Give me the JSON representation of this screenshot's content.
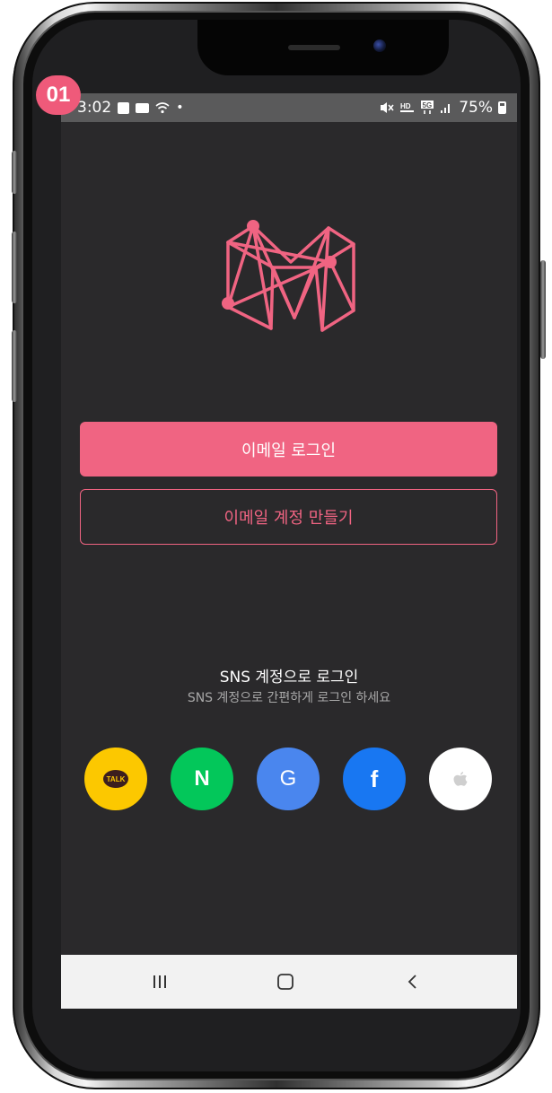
{
  "step_badge": "01",
  "status_bar": {
    "time": "3:02",
    "left_icons": [
      "image-icon",
      "message-icon",
      "wifi-icon",
      "dot-icon"
    ],
    "right_icons": [
      "mute-icon",
      "hd-voice-icon",
      "5g-icon",
      "signal-icon"
    ],
    "battery": "75%"
  },
  "app": {
    "logo": "m-network-logo",
    "brand_color": "#f06482"
  },
  "auth": {
    "login_label": "이메일 로그인",
    "signup_label": "이메일 계정 만들기"
  },
  "sns": {
    "title": "SNS 계정으로 로그인",
    "subtitle": "SNS 계정으로 간편하게 로그인 하세요",
    "providers": [
      {
        "name": "kakao",
        "icon": "kakao-talk-icon",
        "text": "TALK",
        "color": "#fee500"
      },
      {
        "name": "naver",
        "icon": "naver-icon",
        "text": "N",
        "color": "#03c75a"
      },
      {
        "name": "google",
        "icon": "google-icon",
        "text": "G",
        "color": "#4285f4"
      },
      {
        "name": "facebook",
        "icon": "facebook-icon",
        "text": "f",
        "color": "#1877f2"
      },
      {
        "name": "apple",
        "icon": "apple-icon",
        "text": "",
        "color": "#ffffff"
      }
    ]
  },
  "nav": {
    "recent_icon": "recent-apps-icon",
    "home_icon": "home-icon",
    "back_icon": "back-icon"
  }
}
